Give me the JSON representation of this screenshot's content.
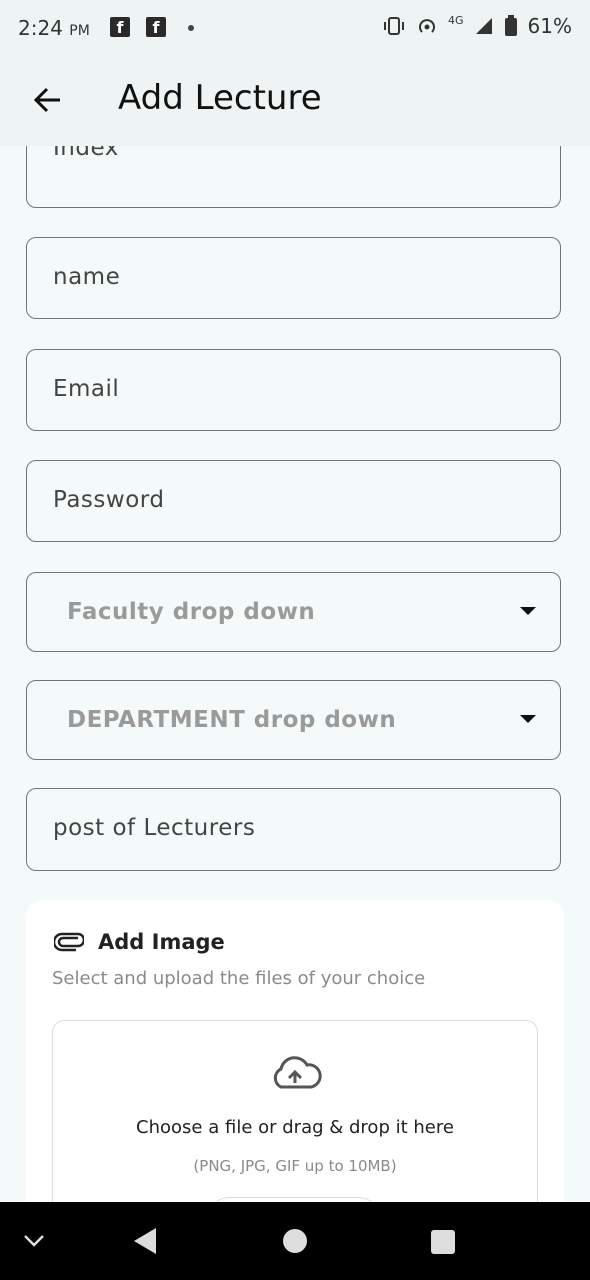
{
  "status_bar": {
    "time": "2:24",
    "ampm": "PM",
    "battery": "61%",
    "network": "4G",
    "icons": [
      "facebook-icon",
      "facebook-icon",
      "vibrate-icon",
      "hotspot-icon",
      "signal-icon",
      "battery-icon"
    ]
  },
  "app_bar": {
    "title": "Add Lecture",
    "back_icon": "arrow-left-icon"
  },
  "form": {
    "index_label": "Index",
    "name_label": "name",
    "email_label": "Email",
    "password_label": "Password",
    "faculty_dropdown": "Faculty drop down",
    "department_dropdown": "DEPARTMENT drop down",
    "post_label": "post of Lecturers"
  },
  "upload_card": {
    "title": "Add Image",
    "subtitle": "Select and upload the files of your choice",
    "dropzone_text": "Choose a file or drag & drop it here",
    "dropzone_hint": "(PNG, JPG, GIF up to 10MB)",
    "icons": [
      "paperclip-icon",
      "cloud-upload-icon"
    ]
  },
  "nav_bar": {
    "icons": [
      "chevron-down-icon",
      "back-triangle-icon",
      "home-circle-icon",
      "recents-square-icon"
    ]
  },
  "colors": {
    "background": "#f4faf9",
    "app_bar": "#eef4f3",
    "field_border": "#6f7775",
    "hint_grey": "#9a9a9a",
    "nav_bar": "#000000"
  }
}
